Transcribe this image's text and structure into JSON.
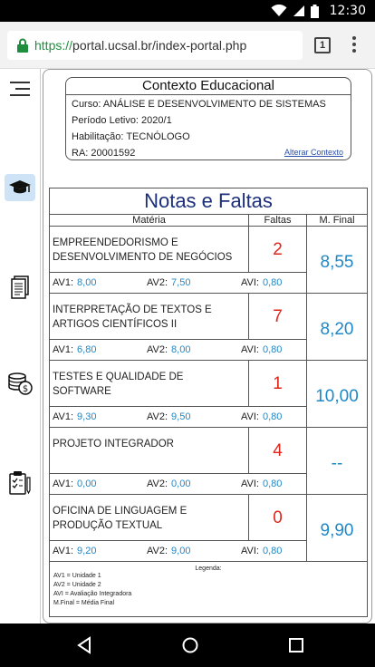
{
  "status_bar": {
    "time": "12:30"
  },
  "browser": {
    "url_protocol": "https://",
    "url_host": "portal.ucsal.br/index-portal.php",
    "tab_count": "1"
  },
  "context": {
    "title": "Contexto Educacional",
    "curso": "Curso: ANÁLISE E DESENVOLVIMENTO DE SISTEMAS",
    "periodo": "Período Letivo: 2020/1",
    "habilitacao": "Habilitação: TECNÓLOGO",
    "ra": "RA: 20001592",
    "change_link": "Alterar Contexto"
  },
  "grades": {
    "title": "Notas e Faltas",
    "headers": {
      "materia": "Matéria",
      "faltas": "Faltas",
      "mfinal": "M. Final"
    },
    "av1_label": "AV1:",
    "av2_label": "AV2:",
    "avi_label": "AVI:",
    "rows": [
      {
        "subject": "EMPREENDEDORISMO E DESENVOLVIMENTO DE NEGÓCIOS",
        "faltas": "2",
        "mfinal": "8,55",
        "av1": "8,00",
        "av2": "7,50",
        "avi": "0,80"
      },
      {
        "subject": "INTERPRETAÇÃO DE TEXTOS E ARTIGOS CIENTÍFICOS II",
        "faltas": "7",
        "mfinal": "8,20",
        "av1": "6,80",
        "av2": "8,00",
        "avi": "0,80"
      },
      {
        "subject": "TESTES E QUALIDADE DE SOFTWARE",
        "faltas": "1",
        "mfinal": "10,00",
        "av1": "9,30",
        "av2": "9,50",
        "avi": "0,80"
      },
      {
        "subject": "PROJETO INTEGRADOR",
        "faltas": "4",
        "mfinal": "--",
        "av1": "0,00",
        "av2": "0,00",
        "avi": "0,80"
      },
      {
        "subject": "OFICINA DE LINGUAGEM E PRODUÇÃO TEXTUAL",
        "faltas": "0",
        "mfinal": "9,90",
        "av1": "9,20",
        "av2": "9,00",
        "avi": "0,80"
      }
    ],
    "legend": {
      "title": "Legenda:",
      "lines": [
        "AV1 = Unidade 1",
        "AV2 = Unidade 2",
        "AVI = Avaliação Integradora",
        "M.Final = Média Final"
      ]
    }
  },
  "sidebar": {
    "items": [
      {
        "icon": "menu-icon"
      },
      {
        "icon": "graduation-cap-icon"
      },
      {
        "icon": "document-icon"
      },
      {
        "icon": "coins-icon"
      },
      {
        "icon": "clipboard-icon"
      }
    ]
  },
  "colors": {
    "grade_blue": "#1e88c8",
    "absence_red": "#e0261b",
    "title_navy": "#1c2f7a",
    "active_tab": "#cfe3f7"
  }
}
